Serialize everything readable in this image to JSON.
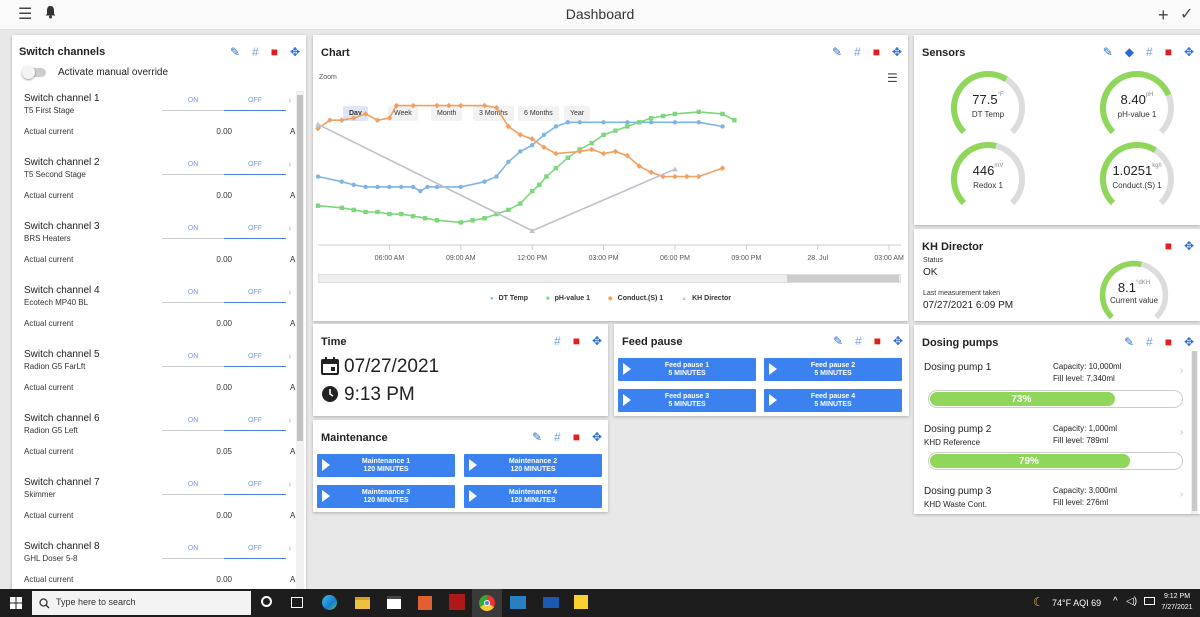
{
  "header": {
    "title": "Dashboard"
  },
  "switch_panel": {
    "title": "Switch channels",
    "override_label": "Activate manual override",
    "channels": [
      {
        "name": "Switch channel 1",
        "sub": "T5 First Stage",
        "on": "ON",
        "off": "OFF",
        "current_label": "Actual current",
        "value": "0.00",
        "unit": "A"
      },
      {
        "name": "Switch channel 2",
        "sub": "T5 Second Stage",
        "on": "ON",
        "off": "OFF",
        "current_label": "Actual current",
        "value": "0.00",
        "unit": "A"
      },
      {
        "name": "Switch channel 3",
        "sub": "BRS Heaters",
        "on": "ON",
        "off": "OFF",
        "current_label": "Actual current",
        "value": "0.00",
        "unit": "A"
      },
      {
        "name": "Switch channel 4",
        "sub": "Ecotech MP40 BL",
        "on": "ON",
        "off": "OFF",
        "current_label": "Actual current",
        "value": "0.00",
        "unit": "A"
      },
      {
        "name": "Switch channel 5",
        "sub": "Radion G5 FarLft",
        "on": "ON",
        "off": "OFF",
        "current_label": "Actual current",
        "value": "0.00",
        "unit": "A"
      },
      {
        "name": "Switch channel 6",
        "sub": "Radion G5 Left",
        "on": "ON",
        "off": "OFF",
        "current_label": "Actual current",
        "value": "0.05",
        "unit": "A"
      },
      {
        "name": "Switch channel 7",
        "sub": "Skimmer",
        "on": "ON",
        "off": "OFF",
        "current_label": "Actual current",
        "value": "0.00",
        "unit": "A"
      },
      {
        "name": "Switch channel 8",
        "sub": "GHL Doser 5-8",
        "on": "ON",
        "off": "OFF",
        "current_label": "Actual current",
        "value": "0.00",
        "unit": "A"
      }
    ]
  },
  "chart_panel": {
    "title": "Chart",
    "zoom_label": "Zoom",
    "zoom_options": [
      "Day",
      "Week",
      "Month",
      "3 Months",
      "6 Months",
      "Year"
    ],
    "selected_zoom": "Day"
  },
  "chart_data": {
    "type": "line",
    "x_tick_labels": [
      "06:00 AM",
      "09:00 AM",
      "12:00 PM",
      "03:00 PM",
      "06:00 PM",
      "09:00 PM",
      "28. Jul",
      "03:00 AM"
    ],
    "series": [
      {
        "name": "DT Temp",
        "color": "#7eb3e6",
        "marker": "circle",
        "points": [
          [
            3.0,
            0.38
          ],
          [
            4.0,
            0.33
          ],
          [
            4.5,
            0.3
          ],
          [
            5.0,
            0.28
          ],
          [
            5.5,
            0.28
          ],
          [
            6.0,
            0.28
          ],
          [
            6.5,
            0.28
          ],
          [
            7.0,
            0.28
          ],
          [
            7.3,
            0.24
          ],
          [
            7.6,
            0.28
          ],
          [
            8.0,
            0.28
          ],
          [
            9.0,
            0.28
          ],
          [
            10.0,
            0.33
          ],
          [
            10.5,
            0.38
          ],
          [
            11.0,
            0.52
          ],
          [
            11.5,
            0.62
          ],
          [
            12.0,
            0.68
          ],
          [
            12.5,
            0.78
          ],
          [
            13.0,
            0.86
          ],
          [
            13.5,
            0.9
          ],
          [
            14.0,
            0.9
          ],
          [
            15.0,
            0.9
          ],
          [
            16.0,
            0.9
          ],
          [
            17.0,
            0.9
          ],
          [
            18.0,
            0.9
          ],
          [
            19.0,
            0.9
          ],
          [
            20.0,
            0.86
          ]
        ]
      },
      {
        "name": "pH-value 1",
        "color": "#7cd67c",
        "marker": "square",
        "points": [
          [
            3.0,
            0.1
          ],
          [
            4.0,
            0.08
          ],
          [
            4.5,
            0.06
          ],
          [
            5.0,
            0.04
          ],
          [
            5.5,
            0.04
          ],
          [
            6.0,
            0.02
          ],
          [
            6.5,
            0.02
          ],
          [
            7.0,
            0.0
          ],
          [
            7.5,
            -0.02
          ],
          [
            8.0,
            -0.04
          ],
          [
            9.0,
            -0.06
          ],
          [
            9.5,
            -0.04
          ],
          [
            10.0,
            -0.02
          ],
          [
            10.5,
            0.02
          ],
          [
            11.0,
            0.06
          ],
          [
            11.5,
            0.12
          ],
          [
            12.0,
            0.24
          ],
          [
            12.3,
            0.3
          ],
          [
            12.6,
            0.38
          ],
          [
            13.0,
            0.46
          ],
          [
            13.5,
            0.56
          ],
          [
            14.0,
            0.64
          ],
          [
            14.5,
            0.7
          ],
          [
            15.0,
            0.78
          ],
          [
            15.5,
            0.82
          ],
          [
            16.0,
            0.86
          ],
          [
            16.5,
            0.9
          ],
          [
            17.0,
            0.94
          ],
          [
            17.5,
            0.96
          ],
          [
            18.0,
            0.98
          ],
          [
            19.0,
            1.0
          ],
          [
            20.0,
            0.98
          ],
          [
            20.5,
            0.92
          ]
        ]
      },
      {
        "name": "Conduct.(S) 1",
        "color": "#f0a060",
        "marker": "diamond",
        "points": [
          [
            3.0,
            0.84
          ],
          [
            3.5,
            0.92
          ],
          [
            4.0,
            0.92
          ],
          [
            4.5,
            0.94
          ],
          [
            5.0,
            0.98
          ],
          [
            5.5,
            0.92
          ],
          [
            6.0,
            0.94
          ],
          [
            6.3,
            1.06
          ],
          [
            7.0,
            1.06
          ],
          [
            8.0,
            1.06
          ],
          [
            8.5,
            1.06
          ],
          [
            9.0,
            1.06
          ],
          [
            10.0,
            1.06
          ],
          [
            10.5,
            1.04
          ],
          [
            11.0,
            0.86
          ],
          [
            11.5,
            0.78
          ],
          [
            12.0,
            0.74
          ],
          [
            12.5,
            0.66
          ],
          [
            13.0,
            0.6
          ],
          [
            14.0,
            0.62
          ],
          [
            14.5,
            0.64
          ],
          [
            15.0,
            0.6
          ],
          [
            15.5,
            0.62
          ],
          [
            16.0,
            0.58
          ],
          [
            16.5,
            0.48
          ],
          [
            17.0,
            0.42
          ],
          [
            17.5,
            0.38
          ],
          [
            18.0,
            0.38
          ],
          [
            18.5,
            0.38
          ],
          [
            19.0,
            0.38
          ],
          [
            20.0,
            0.46
          ]
        ]
      },
      {
        "name": "KH Director",
        "color": "#c0c0cc",
        "marker": "triangle",
        "points": [
          [
            3.0,
            0.88
          ],
          [
            12.0,
            -0.14
          ],
          [
            18.0,
            0.45
          ]
        ]
      }
    ],
    "legend_position": "bottom",
    "grid": false
  },
  "time_panel": {
    "title": "Time",
    "date": "07/27/2021",
    "time": "9:13 PM"
  },
  "maintenance_panel": {
    "title": "Maintenance",
    "buttons": [
      {
        "line1": "Maintenance 1",
        "line2": "120 MINUTES"
      },
      {
        "line1": "Maintenance 2",
        "line2": "120 MINUTES"
      },
      {
        "line1": "Maintenance 3",
        "line2": "120 MINUTES"
      },
      {
        "line1": "Maintenance 4",
        "line2": "120 MINUTES"
      }
    ]
  },
  "feed_panel": {
    "title": "Feed pause",
    "buttons": [
      {
        "line1": "Feed pause 1",
        "line2": "5 MINUTES"
      },
      {
        "line1": "Feed pause 2",
        "line2": "5 MINUTES"
      },
      {
        "line1": "Feed pause 3",
        "line2": "5 MINUTES"
      },
      {
        "line1": "Feed pause 4",
        "line2": "5 MINUTES"
      }
    ]
  },
  "sensors_panel": {
    "title": "Sensors",
    "gauges": [
      {
        "value": "77.5",
        "unit": "°F",
        "label": "DT Temp",
        "fraction": 0.62
      },
      {
        "value": "8.40",
        "unit": "pH",
        "label": "pH-value 1",
        "fraction": 0.75
      },
      {
        "value": "446",
        "unit": "mV",
        "label": "Redox 1",
        "fraction": 0.55
      },
      {
        "value": "1.0251",
        "unit": "kg/l",
        "label": "Conduct.(S) 1",
        "fraction": 0.62
      }
    ]
  },
  "kh_panel": {
    "title": "KH Director",
    "status_label": "Status",
    "status": "OK",
    "last_label": "Last measurement taken",
    "last": "07/27/2021 6:09 PM",
    "gauge": {
      "value": "8.1",
      "unit": "°dKH",
      "label": "Current value",
      "fraction": 0.55
    }
  },
  "dosing_panel": {
    "title": "Dosing pumps",
    "pumps": [
      {
        "name": "Dosing pump 1",
        "sub": "",
        "capacity": "Capacity: 10,000ml",
        "fill": "Fill level: 7,340ml",
        "percent": "73%",
        "fraction": 0.73
      },
      {
        "name": "Dosing pump 2",
        "sub": "KHD Reference",
        "capacity": "Capacity: 1,000ml",
        "fill": "Fill level: 789ml",
        "percent": "79%",
        "fraction": 0.79
      },
      {
        "name": "Dosing pump 3",
        "sub": "KHD Waste Cont.",
        "capacity": "Capacity: 3,000ml",
        "fill": "Fill level: 276ml"
      }
    ]
  },
  "taskbar": {
    "search_placeholder": "Type here to search",
    "weather": "74°F AQI 69",
    "clock_time": "9:12 PM",
    "clock_date": "7/27/2021"
  },
  "colors": {
    "accent": "#3b82f0",
    "gauge_green": "#8fd65a",
    "delete": "#e02020"
  }
}
